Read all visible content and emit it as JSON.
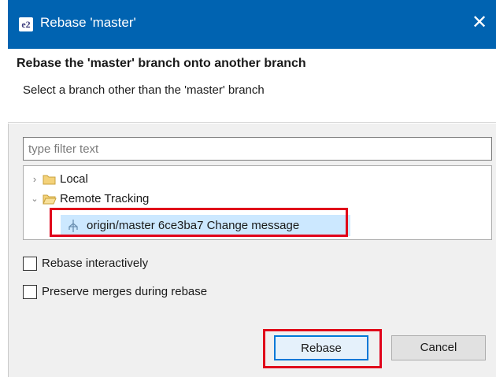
{
  "window": {
    "title": "Rebase 'master'",
    "app_icon": "e2",
    "close_glyph": "✕"
  },
  "header": {
    "title": "Rebase the 'master' branch onto another branch",
    "description": "Select a branch other than the 'master' branch"
  },
  "filter": {
    "placeholder": "type filter text",
    "value": ""
  },
  "tree": {
    "nodes": [
      {
        "label": "Local",
        "expanded": false,
        "icon": "folder-icon"
      },
      {
        "label": "Remote Tracking",
        "expanded": true,
        "icon": "folder-open-icon"
      }
    ],
    "selected": {
      "label": "origin/master 6ce3ba7 Change message",
      "icon": "remote-branch-icon"
    }
  },
  "options": [
    {
      "label": "Rebase interactively",
      "checked": false
    },
    {
      "label": "Preserve merges during rebase",
      "checked": false
    }
  ],
  "buttons": {
    "rebase": "Rebase",
    "cancel": "Cancel"
  },
  "colors": {
    "titlebar": "#0063b1",
    "selection": "#cce8ff",
    "highlight": "#e0001a",
    "default_button_border": "#0078d7"
  }
}
